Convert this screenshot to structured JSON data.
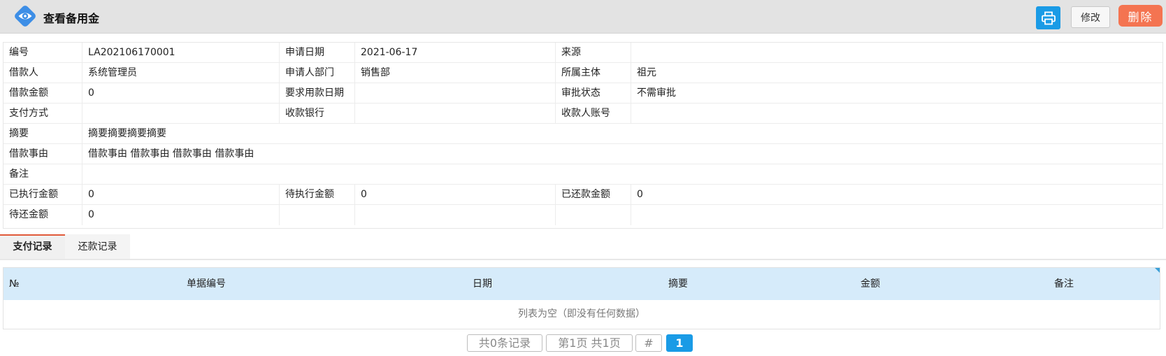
{
  "header": {
    "title": "查看备用金",
    "edit_label": "修改",
    "delete_label": "删除",
    "logo_icon": "eye-icon",
    "print_icon": "printer-icon"
  },
  "detail": {
    "row1": {
      "l1": "编号",
      "v1": "LA202106170001",
      "l2": "申请日期",
      "v2": "2021-06-17",
      "l3": "来源",
      "v3": ""
    },
    "row2": {
      "l1": "借款人",
      "v1": "系统管理员",
      "l2": "申请人部门",
      "v2": "销售部",
      "l3": "所属主体",
      "v3": "祖元"
    },
    "row3": {
      "l1": "借款金额",
      "v1": "0",
      "l2": "要求用款日期",
      "v2": "",
      "l3": "审批状态",
      "v3": "不需审批"
    },
    "row4": {
      "l1": "支付方式",
      "v1": "",
      "l2": "收款银行",
      "v2": "",
      "l3": "收款人账号",
      "v3": ""
    },
    "row5": {
      "l1": "摘要",
      "v": "摘要摘要摘要摘要"
    },
    "row6": {
      "l1": "借款事由",
      "v": "借款事由 借款事由 借款事由 借款事由"
    },
    "row7": {
      "l1": "备注",
      "v": ""
    },
    "row8": {
      "l1": "已执行金额",
      "v1": "0",
      "l2": "待执行金额",
      "v2": "0",
      "l3": "已还款金额",
      "v3": "0"
    },
    "row9": {
      "l1": "待还金额",
      "v1": "0",
      "l2": "",
      "v2": "",
      "l3": "",
      "v3": ""
    }
  },
  "tabs": [
    "支付记录",
    "还款记录"
  ],
  "grid": {
    "columns": [
      "№",
      "单据编号",
      "日期",
      "摘要",
      "金额",
      "备注"
    ],
    "empty_text": "列表为空（即没有任何数据）"
  },
  "pager": {
    "total": "共0条记录",
    "info": "第1页 共1页",
    "hash": "#",
    "current": "1"
  },
  "colors": {
    "header_bg": "#e3e3e3",
    "accent_blue": "#1a9be6",
    "delete_red": "#f47451",
    "grid_head_bg": "#d6ebfa",
    "tab_active_border": "#e05a3a"
  }
}
